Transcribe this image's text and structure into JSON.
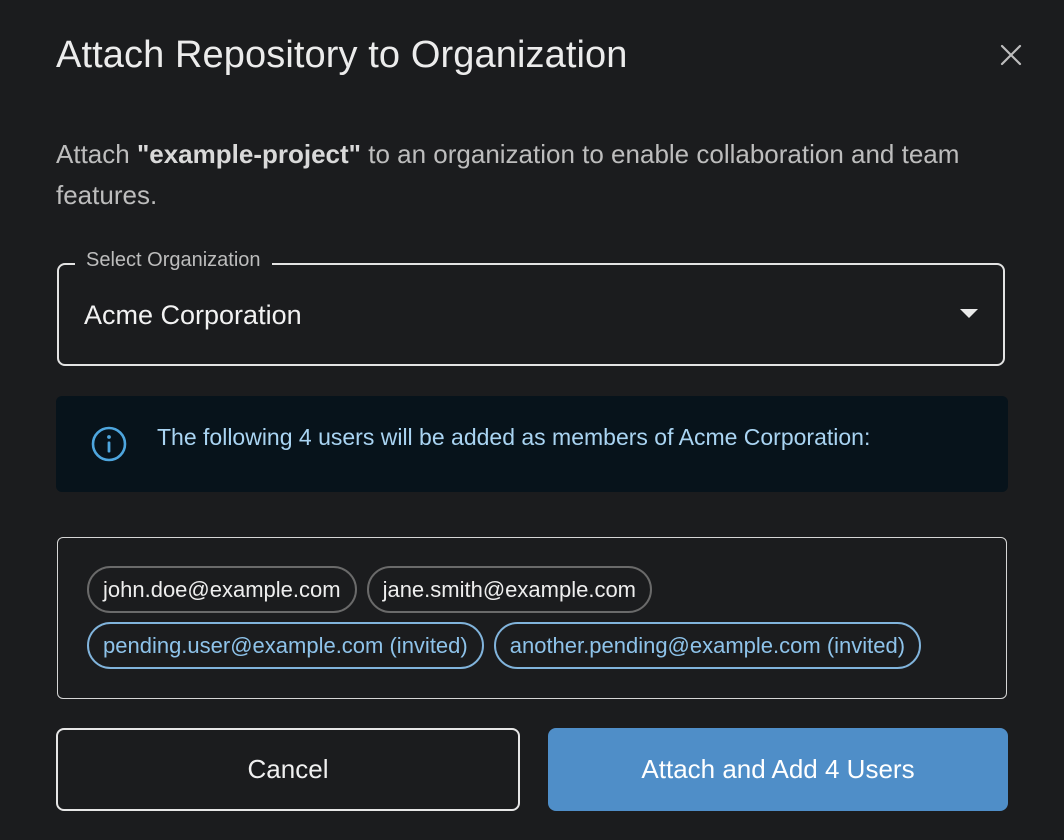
{
  "dialog": {
    "title": "Attach Repository to Organization",
    "close_icon": "close-icon",
    "description": {
      "prefix": "Attach ",
      "repository": "\"example-project\"",
      "suffix": " to an organization to enable collaboration and team features."
    }
  },
  "select": {
    "label": "Select Organization",
    "value": "Acme Corporation",
    "arrow_icon": "dropdown-arrow-icon"
  },
  "info": {
    "icon": "info-icon",
    "text": "The following 4 users will be added as members of Acme Corporation:"
  },
  "users": [
    {
      "email": "john.doe@example.com",
      "status": "member"
    },
    {
      "email": "jane.smith@example.com",
      "status": "member"
    },
    {
      "email": "pending.user@example.com (invited)",
      "status": "pending"
    },
    {
      "email": "another.pending@example.com (invited)",
      "status": "pending"
    }
  ],
  "actions": {
    "cancel_label": "Cancel",
    "attach_label": "Attach and Add 4 Users"
  },
  "colors": {
    "background": "#1b1c1e",
    "accent": "#4f8ec8",
    "info_text": "#a9d4f2",
    "info_background": "#07131b",
    "pending_chip": "#81b4dc"
  }
}
